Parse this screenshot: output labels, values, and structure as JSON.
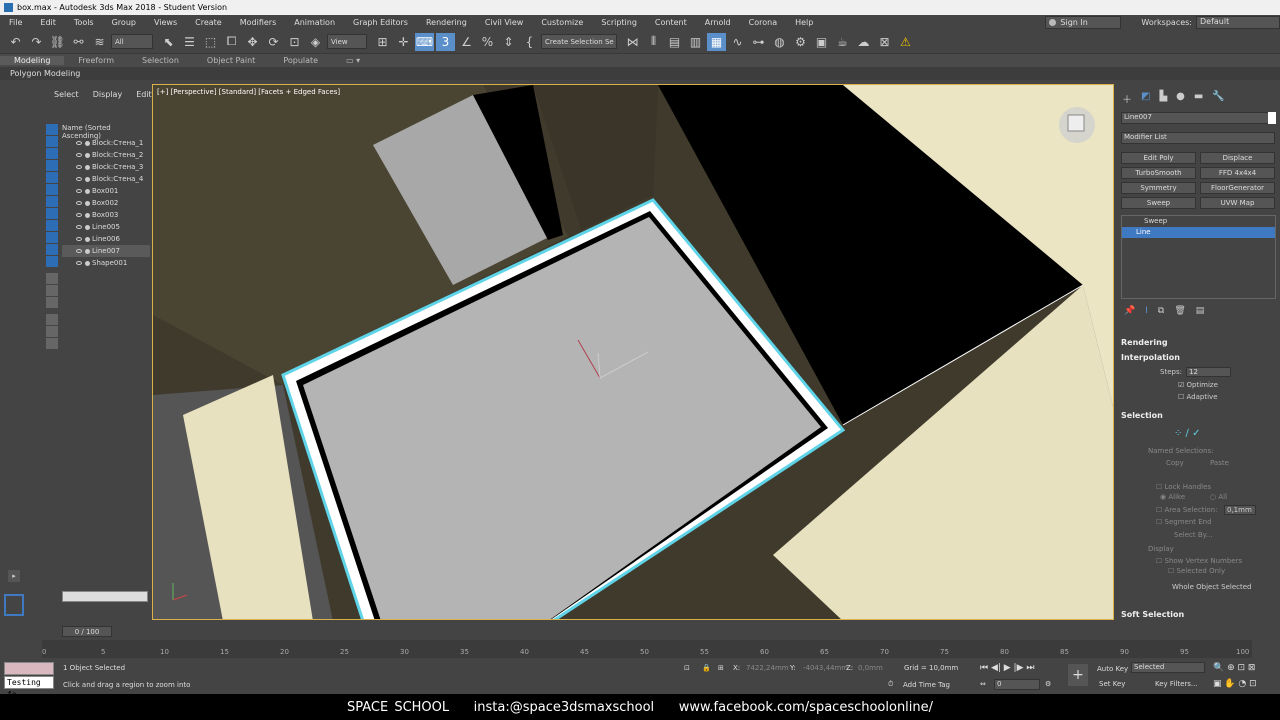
{
  "window": {
    "title": "box.max - Autodesk 3ds Max 2018 - Student Version"
  },
  "menu": [
    "File",
    "Edit",
    "Tools",
    "Group",
    "Views",
    "Create",
    "Modifiers",
    "Animation",
    "Graph Editors",
    "Rendering",
    "Civil View",
    "Customize",
    "Scripting",
    "Content",
    "Arnold",
    "Corona",
    "Help"
  ],
  "account": {
    "signin": "Sign In",
    "workspaces_label": "Workspaces:",
    "workspace": "Default"
  },
  "toolbar": {
    "filter": "All",
    "coord": "View",
    "named_selection": "Create Selection Se"
  },
  "ribbon": {
    "tabs": [
      "Modeling",
      "Freeform",
      "Selection",
      "Object Paint",
      "Populate"
    ],
    "sub": "Polygon Modeling"
  },
  "scene_explorer": {
    "tabs": [
      "Select",
      "Display",
      "Edit"
    ],
    "column": "Name (Sorted Ascending)",
    "items": [
      "Block:Стена_1",
      "Block:Стена_2",
      "Block:Стена_3",
      "Block:Стена_4",
      "Box001",
      "Box002",
      "Box003",
      "Line005",
      "Line006",
      "Line007",
      "Shape001"
    ],
    "selected_index": 9
  },
  "viewport": {
    "label": "[+] [Perspective] [Standard] [Facets + Edged Faces]"
  },
  "command_panel": {
    "object_name": "Line007",
    "modifier_list": "Modifier List",
    "buttons": [
      "Edit Poly",
      "Displace",
      "TurboSmooth",
      "FFD 4x4x4",
      "Symmetry",
      "FloorGenerator",
      "Sweep",
      "UVW Map"
    ],
    "stack": [
      "Sweep",
      "Line"
    ],
    "rollouts": {
      "rendering": "Rendering",
      "interpolation": "Interpolation",
      "selection": "Selection",
      "soft_selection": "Soft Selection"
    },
    "steps_label": "Steps:",
    "steps": "12",
    "optimize": "Optimize",
    "adaptive": "Adaptive",
    "named_selections": "Named Selections:",
    "copy": "Copy",
    "paste": "Paste",
    "lock_handles": "Lock Handles",
    "alike": "Alike",
    "all": "All",
    "area_selection": "Area Selection:",
    "area_value": "0,1mm",
    "segment_end": "Segment End",
    "select_by": "Select By...",
    "display": "Display",
    "show_vertex_numbers": "Show Vertex Numbers",
    "selected_only": "Selected Only",
    "whole_object": "Whole Object Selected"
  },
  "timeline": {
    "frame": "0 / 100",
    "ticks": [
      "0",
      "5",
      "10",
      "15",
      "20",
      "25",
      "30",
      "35",
      "40",
      "45",
      "50",
      "55",
      "60",
      "65",
      "70",
      "75",
      "80",
      "85",
      "90",
      "95",
      "100"
    ]
  },
  "status": {
    "selected": "1 Object Selected",
    "prompt": "Click and drag a region to zoom into",
    "listener": "Testing fo",
    "x_label": "X:",
    "x": "7422,24mm",
    "y_label": "Y:",
    "y": "-4043,44mm",
    "z_label": "Z:",
    "z": "0,0mm",
    "grid": "Grid = 10,0mm",
    "add_time_tag": "Add Time Tag",
    "auto_key": "Auto Key",
    "set_key": "Set Key",
    "key_dropdown": "Selected",
    "key_filters": "Key Filters...",
    "frame_field": "0"
  },
  "footer": {
    "text": "SPACE SCHOOL    insta:@space3dsmaxschool    www.facebook.com/spaceschoolonline/"
  }
}
